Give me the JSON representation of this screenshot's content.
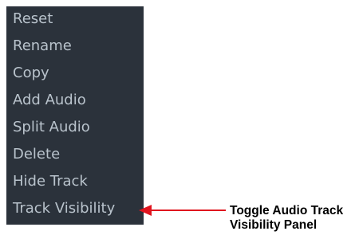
{
  "menu": {
    "items": [
      {
        "label": "Reset"
      },
      {
        "label": "Rename"
      },
      {
        "label": "Copy"
      },
      {
        "label": "Add Audio"
      },
      {
        "label": "Split Audio"
      },
      {
        "label": "Delete"
      },
      {
        "label": "Hide Track"
      },
      {
        "label": "Track Visibility"
      }
    ]
  },
  "annotation": {
    "line1": "Toggle Audio Track",
    "line2": "Visibility Panel",
    "arrow_color": "#e0141e"
  },
  "colors": {
    "menu_background": "#2b323b",
    "menu_text": "#b9c3cc"
  }
}
